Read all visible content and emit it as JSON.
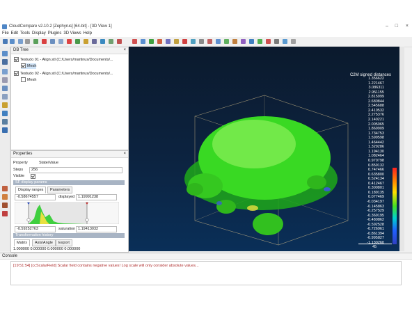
{
  "window": {
    "title": "CloudCompare v2.10.2 [Zephyrus] [64-bit] - [3D View 1]",
    "controls": [
      "–",
      "□",
      "×"
    ]
  },
  "menu": [
    "File",
    "Edit",
    "Tools",
    "Display",
    "Plugins",
    "3D Views",
    "Help"
  ],
  "db_tree": {
    "title": "DB Tree",
    "items": [
      {
        "label": "Testudo 01 - Align.stl (C:/Users/martinus/Documents/...",
        "checked": true
      },
      {
        "label": "Mesh",
        "checked": true
      },
      {
        "label": "Testudo 02 - Align.stl (C:/Users/martinus/Documents/...",
        "checked": true
      },
      {
        "label": "Mesh",
        "checked": false
      }
    ]
  },
  "properties": {
    "title": "Properties",
    "headers": [
      "Property",
      "State/Value"
    ],
    "steps_label": "Steps",
    "steps_value": "256",
    "visible_label": "Visible",
    "sf_params_label": "SF display params",
    "tabs": [
      "Display ranges",
      "Parameters"
    ],
    "range_min": "-0.58674557",
    "displayed_label": "displayed",
    "displayed_value": "1.19991238",
    "sat_min": "-0.59252763",
    "saturation_label": "saturation",
    "saturation_value": "1.19413032",
    "transform_label": "Transformation history",
    "transform_tabs": [
      "Matrix",
      "Axis/Angle",
      "Export"
    ],
    "matrix_row": "1.000000 0.000000 0.000000 0.000000"
  },
  "view": {
    "scale_title": "C2M signed distances",
    "scale_values": [
      "1.356622",
      "1.221467",
      "3.086311",
      "2.951155",
      "2.815999",
      "2.680844",
      "2.545688",
      "2.410532",
      "2.275376",
      "2.140221",
      "2.005065",
      "1.869909",
      "1.734753",
      "1.599598",
      "1.464442",
      "1.329286",
      "1.194130",
      "1.082464",
      "0.970798",
      "0.859132",
      "0.747466",
      "0.635800",
      "0.524134",
      "0.412467",
      "0.300801",
      "0.189135",
      "0.077469",
      "-0.034197",
      "-0.145863",
      "-0.257529",
      "-0.369195",
      "-0.480862",
      "-0.592528",
      "-0.726961",
      "-0.861394",
      "-0.995827",
      "-1.130260"
    ],
    "scale_bar_label": "45",
    "colors": {
      "bg_top": "#0b1a2d",
      "bg_bottom": "#0a2f58",
      "mesh": "#39d923",
      "mesh_light": "#8af05a"
    }
  },
  "console": {
    "title": "Console",
    "message": "[19:51:54] [ccScalarField] Scalar field contains negative values! Log scale will only consider absolute values..."
  }
}
